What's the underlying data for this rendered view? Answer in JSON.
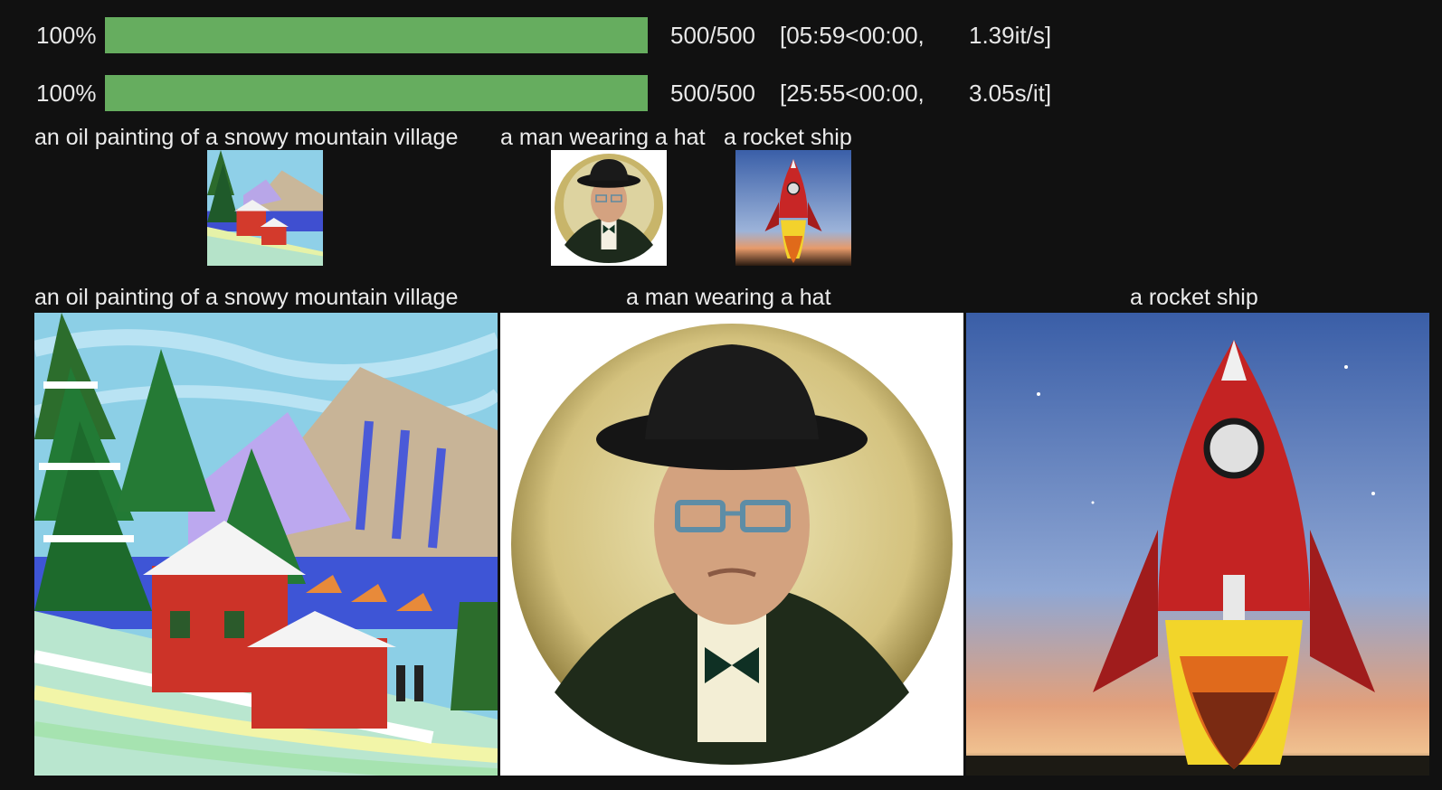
{
  "progress": [
    {
      "percent_label": "100%",
      "fraction": 1.0,
      "count": "500/500",
      "timing": "[05:59<00:00,",
      "rate": "1.39it/s]"
    },
    {
      "percent_label": "100%",
      "fraction": 1.0,
      "count": "500/500",
      "timing": "[25:55<00:00,",
      "rate": "3.05s/it]"
    }
  ],
  "thumbnails": {
    "captions": [
      "an oil painting of a snowy mountain village",
      "a man wearing a hat",
      "a rocket ship"
    ]
  },
  "results": {
    "captions": [
      "an oil painting of a snowy mountain village",
      "a man wearing a hat",
      "a rocket ship"
    ]
  },
  "colors": {
    "background": "#111111",
    "progress_fill": "#66ad5f",
    "text": "#e8e8e8"
  },
  "images": [
    "snowy-village-painting",
    "man-in-hat-portrait",
    "rocket-ship-sunset"
  ]
}
